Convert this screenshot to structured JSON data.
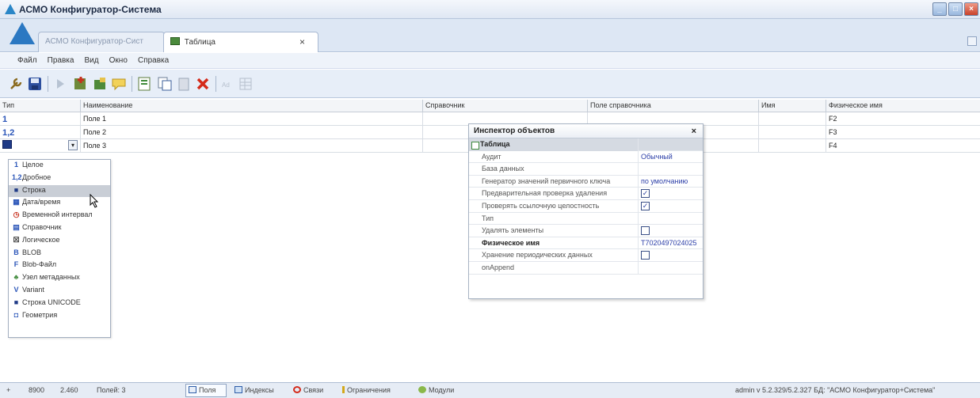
{
  "window": {
    "title": "АСМО Конфигуратор-Система"
  },
  "tabs": [
    {
      "label": "АСМО Конфигуратор-Сист",
      "active": false
    },
    {
      "label": "Таблица",
      "active": true
    }
  ],
  "menu": [
    "Файл",
    "Правка",
    "Вид",
    "Окно",
    "Справка"
  ],
  "toolbar_icons": [
    "wrench-icon",
    "save-icon",
    "play-icon",
    "add-field-icon",
    "edit-field-icon",
    "comment-icon",
    "properties-icon",
    "copy-icon",
    "paste-icon",
    "delete-icon",
    "rename-icon",
    "grid-icon"
  ],
  "grid": {
    "columns": [
      "Тип",
      "Наименование",
      "Справочник",
      "Поле справочника",
      "Имя",
      "Физическое имя"
    ],
    "rows": [
      {
        "type_icon": "1",
        "name": "Поле 1",
        "phys": "F2"
      },
      {
        "type_icon": "1,2",
        "name": "Поле 2",
        "phys": "F3"
      },
      {
        "type_icon": "",
        "name": "Поле 3",
        "phys": "F4"
      }
    ]
  },
  "type_dropdown": {
    "items": [
      {
        "icon": "1",
        "label": "Целое"
      },
      {
        "icon": "1,2",
        "label": "Дробное"
      },
      {
        "icon": "■",
        "label": "Строка",
        "selected": true
      },
      {
        "icon": "▦",
        "label": "Дата/время"
      },
      {
        "icon": "◷",
        "label": "Временной интервал"
      },
      {
        "icon": "▤",
        "label": "Справочник"
      },
      {
        "icon": "☒",
        "label": "Логическое"
      },
      {
        "icon": "B",
        "label": "BLOB"
      },
      {
        "icon": "F",
        "label": "Blob-Файл"
      },
      {
        "icon": "♣",
        "label": "Узел метаданных"
      },
      {
        "icon": "V",
        "label": "Variant"
      },
      {
        "icon": "■",
        "label": "Строка UNICODE"
      },
      {
        "icon": "◘",
        "label": "Геометрия"
      }
    ]
  },
  "inspector": {
    "title": "Инспектор объектов",
    "category": "Таблица",
    "props": [
      {
        "label": "Аудит",
        "value": "Обычный",
        "kind": "text"
      },
      {
        "label": "База данных",
        "value": "",
        "kind": "text"
      },
      {
        "label": "Генератор значений первичного ключа",
        "value": "по умолчанию",
        "kind": "text"
      },
      {
        "label": "Предварительная проверка удаления",
        "value": "✓",
        "kind": "check"
      },
      {
        "label": "Проверять ссылочную целостность",
        "value": "✓",
        "kind": "check"
      },
      {
        "label": "Тип",
        "value": "",
        "kind": "text"
      },
      {
        "label": "Удалять элементы",
        "value": "",
        "kind": "check"
      },
      {
        "label": "Физическое имя",
        "value": "T7020497024025",
        "kind": "text",
        "bold": true
      },
      {
        "label": "Хранение периодических данных",
        "value": "",
        "kind": "check"
      },
      {
        "label": "onAppend",
        "value": "",
        "kind": "text"
      }
    ]
  },
  "statusbar": {
    "plus": "+",
    "code": "8900",
    "version_num": "2.460",
    "fields_count": "Полей: 3",
    "tabs": [
      "Поля",
      "Индексы",
      "Связи",
      "Ограничения",
      "Модули"
    ],
    "info": "admin v 5.2.329/5.2.327 БД: \"АСМО Конфигуратор+Система\""
  },
  "colors": {
    "title_bg": "#dfe7f3",
    "accent_blue": "#2a55b8",
    "close_red": "#c9412a"
  }
}
